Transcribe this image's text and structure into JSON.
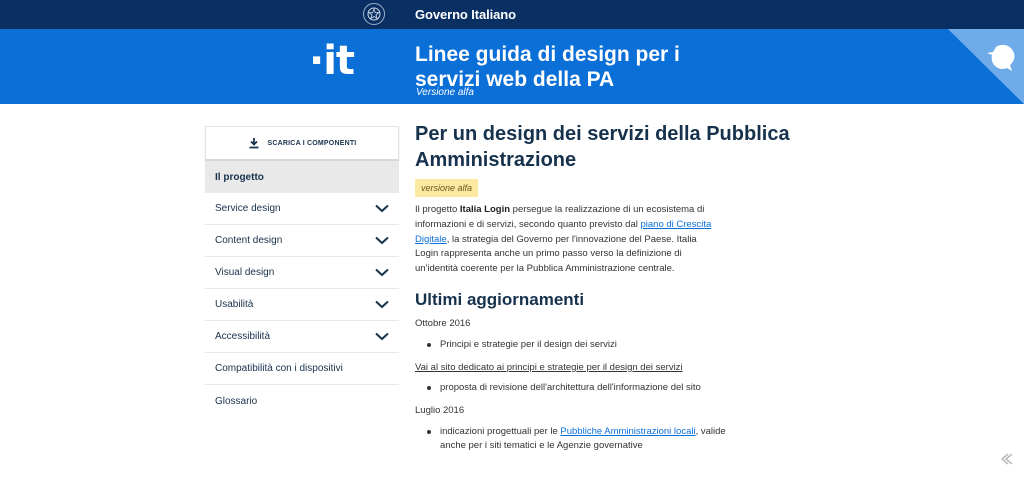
{
  "gov_bar": {
    "title": "Governo Italiano"
  },
  "header": {
    "logo": "·it",
    "title": "Linee guida di design per i servizi web della PA",
    "subtitle": "Versione alfa"
  },
  "sidebar": {
    "download_label": "SCARICA I COMPONENTI",
    "items": [
      {
        "label": "Il progetto",
        "active": true,
        "expandable": false
      },
      {
        "label": "Service design",
        "active": false,
        "expandable": true
      },
      {
        "label": "Content design",
        "active": false,
        "expandable": true
      },
      {
        "label": "Visual design",
        "active": false,
        "expandable": true
      },
      {
        "label": "Usabilità",
        "active": false,
        "expandable": true
      },
      {
        "label": "Accessibilità",
        "active": false,
        "expandable": true
      },
      {
        "label": "Compatibilità con i dispositivi",
        "active": false,
        "expandable": false
      },
      {
        "label": "Glossario",
        "active": false,
        "expandable": false
      }
    ]
  },
  "main": {
    "title": "Per un design dei servizi della Pubblica Amministrazione",
    "badge": "versione alfa",
    "intro": {
      "p1": "Il progetto ",
      "bold": "Italia Login",
      "p2": " persegue la realizzazione di un ecosistema di informazioni e di servizi, secondo quanto previsto dal ",
      "link": "piano di Crescita Digitale",
      "p3": ", la strategia del Governo per l'innovazione del Paese. Italia Login rappresenta anche un primo passo verso la definizione di un'identità coerente per la Pubblica Amministrazione centrale."
    },
    "updates_title": "Ultimi aggiornamenti",
    "update1_date": "Ottobre 2016",
    "update1_bullet": "Principi e strategie per il design dei servizi",
    "update1_link": "Vai al sito dedicato ai principi e strategie per il design dei servizi",
    "update1_bullet2": "proposta di revisione dell'architettura dell'informazione del sito",
    "update2_date": "Luglio 2016",
    "update2_bullet_a": "indicazioni progettuali per le ",
    "update2_link": "Pubbliche Amministrazioni locali",
    "update2_bullet_b": ", valide anche per i siti tematici e le Agenzie governative"
  },
  "colors": {
    "gov_bar": "#0a2f63",
    "header": "#0b6fd8",
    "link": "#0b6fd8",
    "badge": "#fbe8a1"
  }
}
